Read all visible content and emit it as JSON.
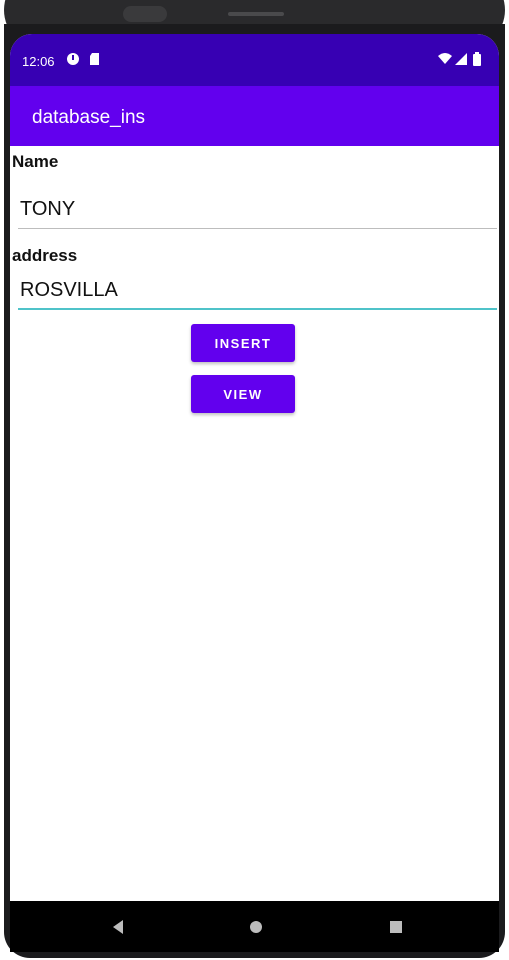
{
  "status_bar": {
    "time": "12:06",
    "icons": [
      "data-saver-icon",
      "sd-card-icon",
      "wifi-icon",
      "cellular-signal-icon",
      "battery-icon"
    ]
  },
  "app_bar": {
    "title": "database_ins"
  },
  "form": {
    "name_label": "Name",
    "name_value": "TONY",
    "address_label": "address",
    "address_value": "ROSVILLA"
  },
  "buttons": {
    "insert_label": "INSERT",
    "view_label": "VIEW"
  },
  "nav_bar": {
    "icons": [
      "back-icon",
      "home-icon",
      "recents-icon"
    ]
  },
  "colors": {
    "status_bar": "#3700b3",
    "app_bar": "#6200ee",
    "button": "#6200ee",
    "focused_underline": "#4fc3c9"
  }
}
